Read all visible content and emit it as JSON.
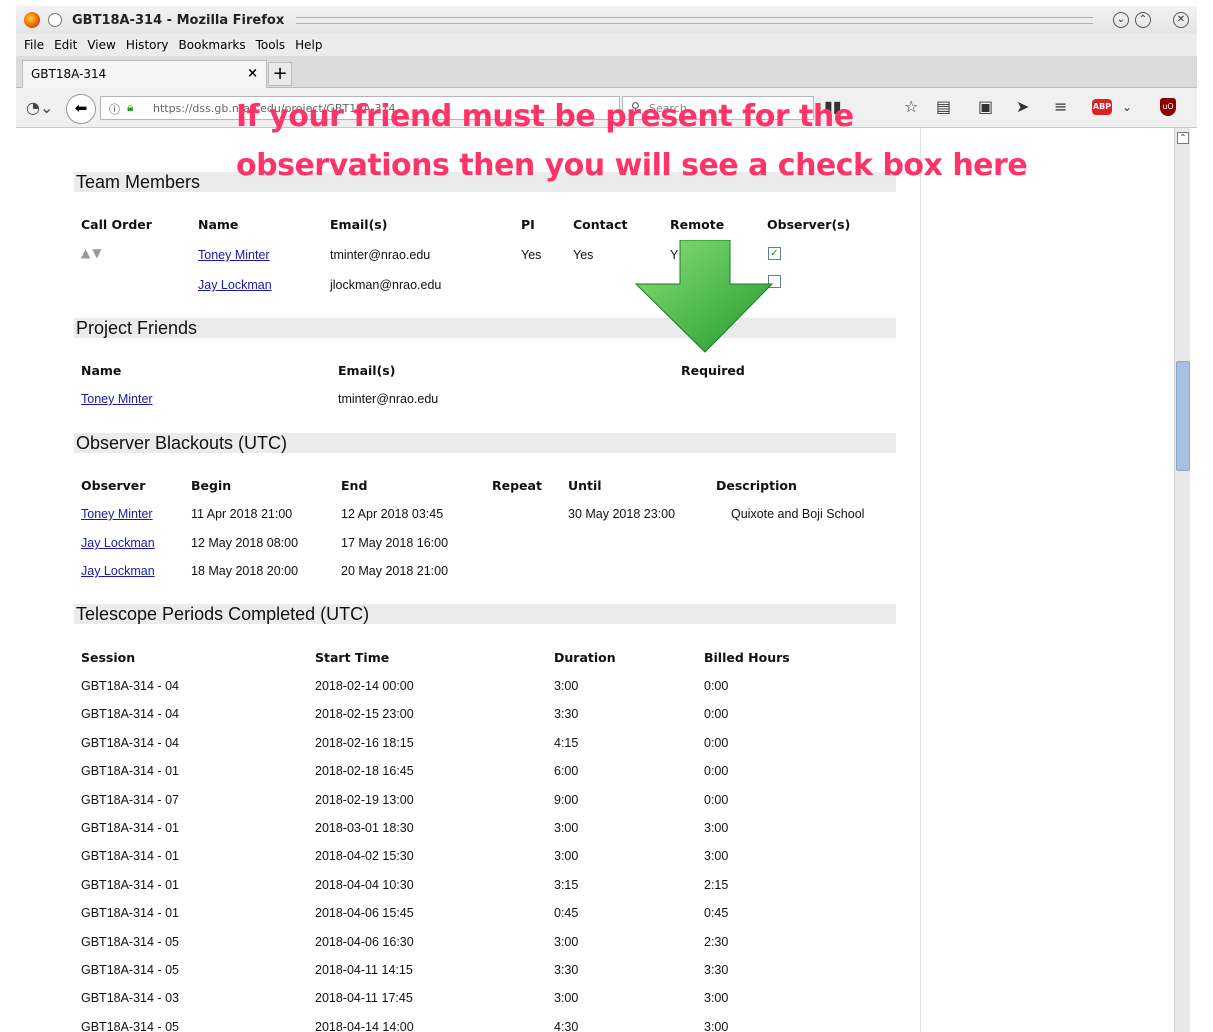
{
  "window": {
    "title": "GBT18A-314 - Mozilla Firefox"
  },
  "menu": [
    "File",
    "Edit",
    "View",
    "History",
    "Bookmarks",
    "Tools",
    "Help"
  ],
  "tab": {
    "label": "GBT18A-314"
  },
  "url": "https://dss.gb.nrao.edu/project/GBT18A-314",
  "search_placeholder": "Search",
  "overlay": {
    "line1": "If your friend must be present for the",
    "line2": "observations then you will see a check box here"
  },
  "team": {
    "title": "Team Members",
    "headers": [
      "Call Order",
      "Name",
      "Email(s)",
      "PI",
      "Contact",
      "Remote",
      "Observer(s)"
    ],
    "rows": [
      {
        "name": "Toney Minter",
        "email": "tminter@nrao.edu",
        "pi": "Yes",
        "contact": "Yes",
        "remote": "Y",
        "observer": true
      },
      {
        "name": "Jay Lockman",
        "email": "jlockman@nrao.edu",
        "pi": "",
        "contact": "",
        "remote": "",
        "observer": false
      }
    ]
  },
  "friends": {
    "title": "Project Friends",
    "headers": [
      "Name",
      "Email(s)",
      "Required"
    ],
    "rows": [
      {
        "name": "Toney Minter",
        "email": "tminter@nrao.edu"
      }
    ]
  },
  "blackouts": {
    "title": "Observer Blackouts (UTC)",
    "headers": [
      "Observer",
      "Begin",
      "End",
      "Repeat",
      "Until",
      "Description"
    ],
    "rows": [
      {
        "observer": "Toney Minter",
        "begin": "11 Apr 2018 21:00",
        "end": "12 Apr 2018 03:45",
        "repeat": "",
        "until": "30 May 2018 23:00",
        "description": "Quixote and Boji School"
      },
      {
        "observer": "Jay Lockman",
        "begin": "12 May 2018 08:00",
        "end": "17 May 2018 16:00",
        "repeat": "",
        "until": "",
        "description": ""
      },
      {
        "observer": "Jay Lockman",
        "begin": "18 May 2018 20:00",
        "end": "20 May 2018 21:00",
        "repeat": "",
        "until": "",
        "description": ""
      }
    ]
  },
  "periods": {
    "title": "Telescope Periods Completed (UTC)",
    "headers": [
      "Session",
      "Start Time",
      "Duration",
      "Billed Hours"
    ],
    "rows": [
      [
        "GBT18A-314 - 04",
        "2018-02-14 00:00",
        "3:00",
        "0:00"
      ],
      [
        "GBT18A-314 - 04",
        "2018-02-15 23:00",
        "3:30",
        "0:00"
      ],
      [
        "GBT18A-314 - 04",
        "2018-02-16 18:15",
        "4:15",
        "0:00"
      ],
      [
        "GBT18A-314 - 01",
        "2018-02-18 16:45",
        "6:00",
        "0:00"
      ],
      [
        "GBT18A-314 - 07",
        "2018-02-19 13:00",
        "9:00",
        "0:00"
      ],
      [
        "GBT18A-314 - 01",
        "2018-03-01 18:30",
        "3:00",
        "3:00"
      ],
      [
        "GBT18A-314 - 01",
        "2018-04-02 15:30",
        "3:00",
        "3:00"
      ],
      [
        "GBT18A-314 - 01",
        "2018-04-04 10:30",
        "3:15",
        "2:15"
      ],
      [
        "GBT18A-314 - 01",
        "2018-04-06 15:45",
        "0:45",
        "0:45"
      ],
      [
        "GBT18A-314 - 05",
        "2018-04-06 16:30",
        "3:00",
        "2:30"
      ],
      [
        "GBT18A-314 - 05",
        "2018-04-11 14:15",
        "3:30",
        "3:30"
      ],
      [
        "GBT18A-314 - 03",
        "2018-04-11 17:45",
        "3:00",
        "3:00"
      ],
      [
        "GBT18A-314 - 05",
        "2018-04-14 14:00",
        "4:30",
        "3:00"
      ]
    ]
  }
}
